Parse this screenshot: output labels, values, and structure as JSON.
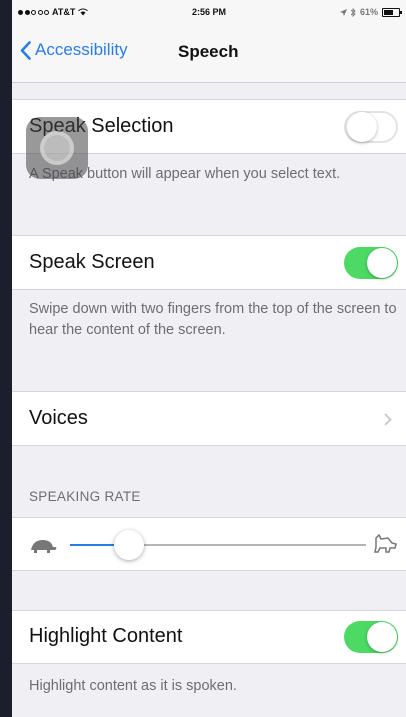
{
  "status_bar": {
    "carrier": "AT&T",
    "time": "2:56 PM",
    "battery": "61%",
    "battery_level": 0.61
  },
  "nav": {
    "back_label": "Accessibility",
    "title": "Speech"
  },
  "speak_selection": {
    "label": "Speak Selection",
    "enabled": false,
    "footer": "A Speak button will appear when you select text."
  },
  "speak_screen": {
    "label": "Speak Screen",
    "enabled": true,
    "footer": "Swipe down with two fingers from the top of the screen to hear the content of the screen."
  },
  "voices": {
    "label": "Voices"
  },
  "speaking_rate": {
    "header": "SPEAKING RATE",
    "value": 0.2
  },
  "highlight_content": {
    "label": "Highlight Content",
    "enabled": true,
    "footer": "Highlight content as it is spoken."
  },
  "colors": {
    "accent": "#2a7de1",
    "toggle_on": "#4cd964",
    "background": "#efeff4"
  },
  "icons": {
    "back": "chevron-left-icon",
    "disclosure": "chevron-right-icon",
    "slow": "tortoise-icon",
    "fast": "hare-icon",
    "wifi": "wifi-icon",
    "location": "location-arrow-icon",
    "bluetooth": "bluetooth-icon",
    "battery": "battery-icon",
    "assistive_touch": "assistive-touch-icon"
  }
}
